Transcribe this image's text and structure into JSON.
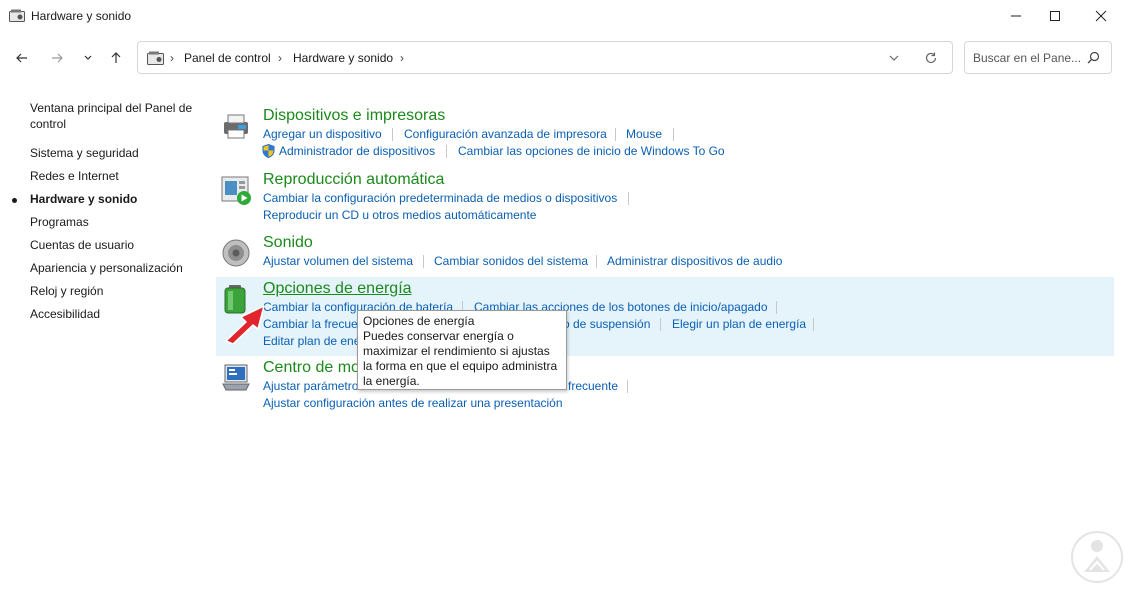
{
  "window": {
    "title": "Hardware y sonido",
    "icon": "control-panel-icon"
  },
  "nav": {
    "back": "arrow-left-icon",
    "forward": "arrow-right-icon",
    "recent": "chevron-down-icon",
    "up": "arrow-up-icon"
  },
  "address": {
    "crumbs": [
      "Panel de control",
      "Hardware y sonido"
    ],
    "separator": "›"
  },
  "search": {
    "placeholder": "Buscar en el Pane..."
  },
  "sidebar": {
    "items": [
      {
        "label": "Ventana principal del Panel de control"
      },
      {
        "label": "Sistema y seguridad"
      },
      {
        "label": "Redes e Internet"
      },
      {
        "label": "Hardware y sonido",
        "active": true
      },
      {
        "label": "Programas"
      },
      {
        "label": "Cuentas de usuario"
      },
      {
        "label": "Apariencia y personalización"
      },
      {
        "label": "Reloj y región"
      },
      {
        "label": "Accesibilidad"
      }
    ]
  },
  "categories": [
    {
      "title": "Dispositivos e impresoras",
      "icon": "printer-icon",
      "links": [
        "Agregar un dispositivo",
        "Configuración avanzada de impresora",
        "Mouse",
        "Administrador de dispositivos",
        "Cambiar las opciones de inicio de Windows To Go"
      ]
    },
    {
      "title": "Reproducción automática",
      "icon": "autoplay-icon",
      "links": [
        "Cambiar la configuración predeterminada de medios o dispositivos",
        "Reproducir un CD u otros medios automáticamente"
      ]
    },
    {
      "title": "Sonido",
      "icon": "speaker-icon",
      "links": [
        "Ajustar volumen del sistema",
        "Cambiar sonidos del sistema",
        "Administrar dispositivos de audio"
      ]
    },
    {
      "title": "Opciones de energía",
      "icon": "battery-icon",
      "links": [
        "Cambiar la configuración de batería",
        "Cambiar las acciones de los botones de inicio/apagado",
        "Cambiar la frecue",
        "o de suspensión",
        "Elegir un plan de energía",
        "Editar plan de ene"
      ]
    },
    {
      "title": "Centro de mo",
      "icon": "mobility-center-icon",
      "links": [
        "Ajustar parámetros",
        "frecuente",
        "Ajustar configuración antes de realizar una presentación"
      ]
    }
  ],
  "tooltip": {
    "title": "Opciones de energía",
    "body": "Puedes conservar energía o maximizar el rendimiento si ajustas la forma en que el equipo administra la energía."
  },
  "colors": {
    "category_title": "#1b8a1b",
    "link": "#0a5fb4",
    "hover_bg": "#e5f3fb",
    "arrow": "#e0262c"
  }
}
